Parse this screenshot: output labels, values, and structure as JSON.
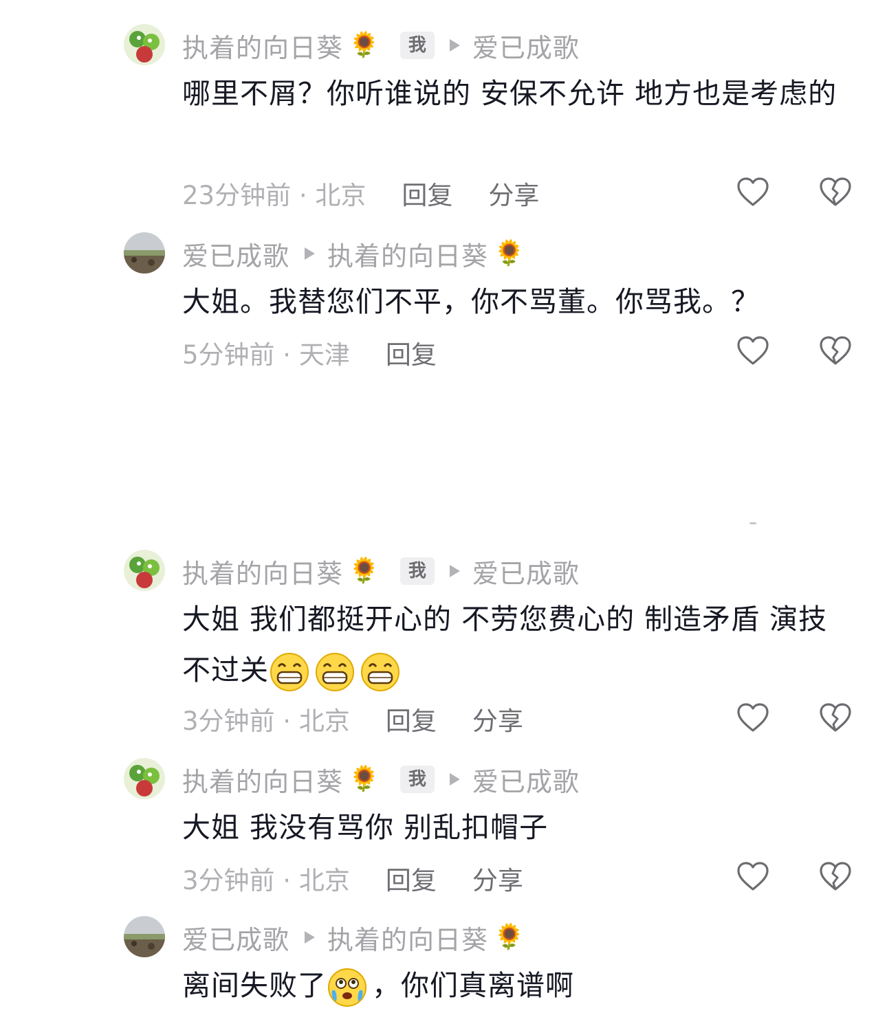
{
  "comments": [
    {
      "author": "执着的向日葵",
      "author_emoji": "🌻",
      "me_badge": "我",
      "reply_to": "爱已成歌",
      "reply_to_emoji": "",
      "text": "哪里不屑？你听谁说的 安保不允许 地方也是考虑的",
      "time_location": "23分钟前 · 北京",
      "reply_label": "回复",
      "share_label": "分享"
    },
    {
      "author": "爱已成歌",
      "author_emoji": "",
      "me_badge": "",
      "reply_to": "执着的向日葵",
      "reply_to_emoji": "🌻",
      "text": "大姐。我替您们不平，你不骂董。你骂我。？",
      "time_location": "5分钟前 · 天津",
      "reply_label": "回复",
      "share_label": ""
    },
    {
      "author": "执着的向日葵",
      "author_emoji": "🌻",
      "me_badge": "我",
      "reply_to": "爱已成歌",
      "reply_to_emoji": "",
      "text": "大姐 我们都挺开心的 不劳您费心的 制造矛盾 演技不过关",
      "time_location": "3分钟前 · 北京",
      "reply_label": "回复",
      "share_label": "分享"
    },
    {
      "author": "执着的向日葵",
      "author_emoji": "🌻",
      "me_badge": "我",
      "reply_to": "爱已成歌",
      "reply_to_emoji": "",
      "text": "大姐 我没有骂你 别乱扣帽子",
      "time_location": "3分钟前 · 北京",
      "reply_label": "回复",
      "share_label": "分享"
    },
    {
      "author": "爱已成歌",
      "author_emoji": "",
      "me_badge": "",
      "reply_to": "执着的向日葵",
      "reply_to_emoji": "🌻",
      "text_part1": "离间失败了",
      "text_part2": "，你们真离谱啊"
    }
  ],
  "icons": {
    "like": "heart-outline-icon",
    "dislike": "broken-heart-outline-icon",
    "grin_emoji": "grinning-face-emoji",
    "cry_emoji": "crying-face-emoji"
  }
}
